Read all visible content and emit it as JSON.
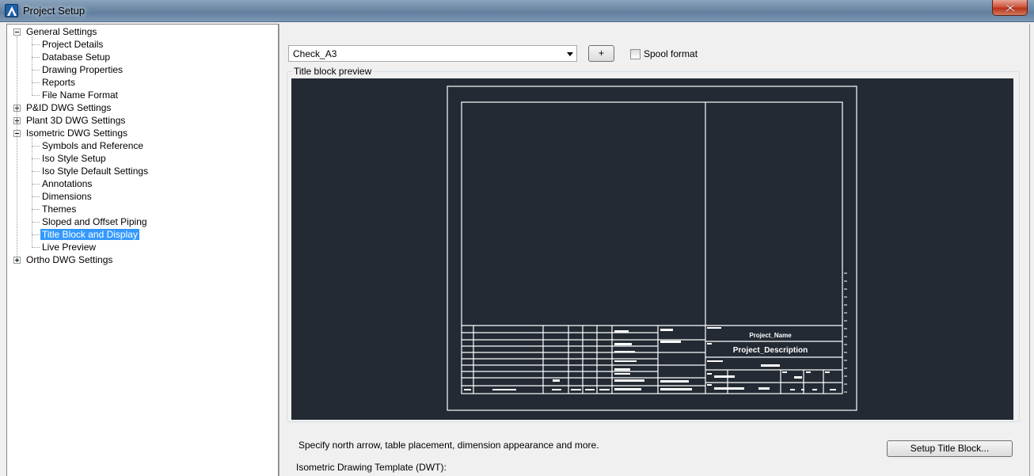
{
  "window": {
    "title": "Project Setup",
    "app_icon": "autocad-a-icon",
    "close_icon": "close-icon"
  },
  "tree": {
    "items": [
      {
        "label": "General Settings",
        "level": 0,
        "expander": "minus"
      },
      {
        "label": "Project Details",
        "level": 1
      },
      {
        "label": "Database Setup",
        "level": 1
      },
      {
        "label": "Drawing Properties",
        "level": 1
      },
      {
        "label": "Reports",
        "level": 1
      },
      {
        "label": "File Name Format",
        "level": 1
      },
      {
        "label": "P&ID DWG Settings",
        "level": 0,
        "expander": "plus"
      },
      {
        "label": "Plant 3D DWG Settings",
        "level": 0,
        "expander": "plus"
      },
      {
        "label": "Isometric DWG Settings",
        "level": 0,
        "expander": "minus"
      },
      {
        "label": "Symbols and Reference",
        "level": 1
      },
      {
        "label": "Iso Style Setup",
        "level": 1
      },
      {
        "label": "Iso Style Default Settings",
        "level": 1
      },
      {
        "label": "Annotations",
        "level": 1
      },
      {
        "label": "Dimensions",
        "level": 1
      },
      {
        "label": "Themes",
        "level": 1
      },
      {
        "label": "Sloped and Offset Piping",
        "level": 1
      },
      {
        "label": "Title Block and Display",
        "level": 1,
        "selected": true
      },
      {
        "label": "Live Preview",
        "level": 1
      },
      {
        "label": "Ortho DWG Settings",
        "level": 0,
        "expander": "plus"
      }
    ]
  },
  "format": {
    "selected": "Check_A3",
    "add_label": "+",
    "spool_label": "Spool format",
    "spool_checked": false
  },
  "preview": {
    "group_label": "Title block preview",
    "background": "#232a33",
    "title_block": {
      "project_name": "Project_Name",
      "project_description": "Project_Description"
    }
  },
  "description": "Specify north arrow, table placement, dimension appearance and more.",
  "setup_button_label": "Setup Title Block...",
  "template_label": "Isometric Drawing Template (DWT):",
  "colors": {
    "selection": "#3399ff",
    "dialog_bg": "#f0f0f0"
  }
}
